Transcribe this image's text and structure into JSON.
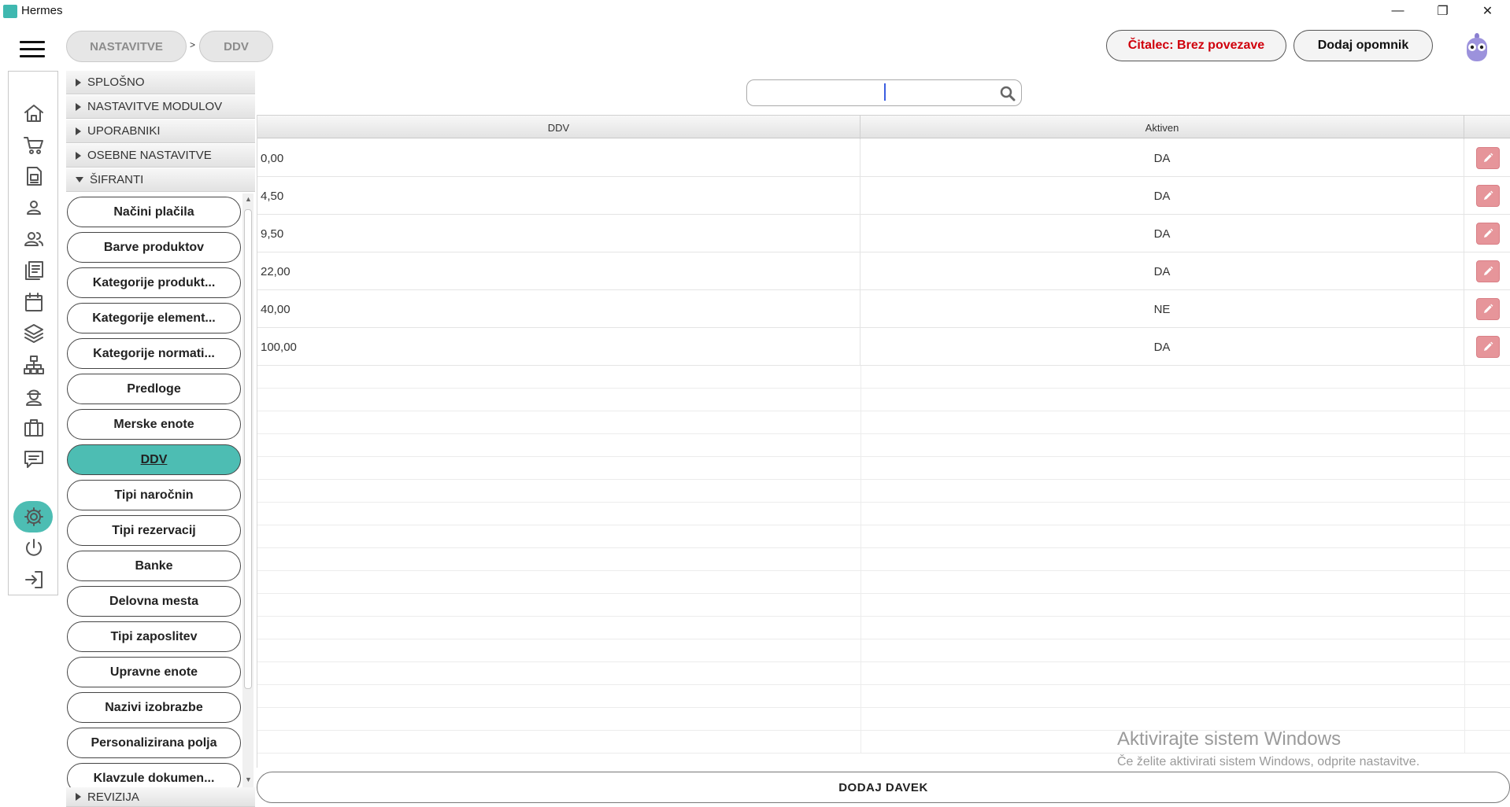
{
  "window": {
    "title": "Hermes",
    "minimize_glyph": "—",
    "restore_glyph": "❐",
    "close_glyph": "✕"
  },
  "breadcrumb": {
    "items": [
      "NASTAVITVE",
      "DDV"
    ],
    "separator": ">"
  },
  "header": {
    "reader_status": "Čitalec: Brez povezave",
    "reader_status_color": "#d0000c",
    "add_reminder": "Dodaj opomnik"
  },
  "rail": {
    "icons": [
      "home-icon",
      "cart-icon",
      "document-icon",
      "person-icon",
      "people-icon",
      "news-icon",
      "calendar-icon",
      "layers-icon",
      "network-icon",
      "worker-icon",
      "briefcase-icon",
      "chat-icon",
      "settings-icon",
      "power-icon",
      "logout-icon"
    ],
    "active": "settings-icon",
    "accent": "#4dbdb3"
  },
  "settings_menu": {
    "sections": [
      "SPLOŠNO",
      "NASTAVITVE MODULOV",
      "UPORABNIKI",
      "OSEBNE NASTAVITVE",
      "ŠIFRANTI"
    ],
    "expanded_section": "ŠIFRANTI",
    "items": [
      "Načini plačila",
      "Barve produktov",
      "Kategorije produkt...",
      "Kategorije element...",
      "Kategorije normati...",
      "Predloge",
      "Merske enote",
      "DDV",
      "Tipi naročnin",
      "Tipi rezervacij",
      "Banke",
      "Delovna mesta",
      "Tipi zaposlitev",
      "Upravne enote",
      "Nazivi izobrazbe",
      "Personalizirana polja",
      "Klavzule dokumen..."
    ],
    "active_item": "DDV",
    "after_section": "REVIZIJA"
  },
  "search": {
    "value": "",
    "placeholder": ""
  },
  "table": {
    "columns": [
      "DDV",
      "Aktiven",
      ""
    ],
    "rows": [
      {
        "ddv": "0,00",
        "aktiven": "DA"
      },
      {
        "ddv": "4,50",
        "aktiven": "DA"
      },
      {
        "ddv": "9,50",
        "aktiven": "DA"
      },
      {
        "ddv": "22,00",
        "aktiven": "DA"
      },
      {
        "ddv": "40,00",
        "aktiven": "NE"
      },
      {
        "ddv": "100,00",
        "aktiven": "DA"
      }
    ],
    "edit_color": "#e6959a"
  },
  "footer": {
    "add_button": "DODAJ DAVEK"
  },
  "watermark": {
    "line1": "Aktivirajte sistem Windows",
    "line2": "Če želite aktivirati sistem Windows, odprite nastavitve."
  }
}
